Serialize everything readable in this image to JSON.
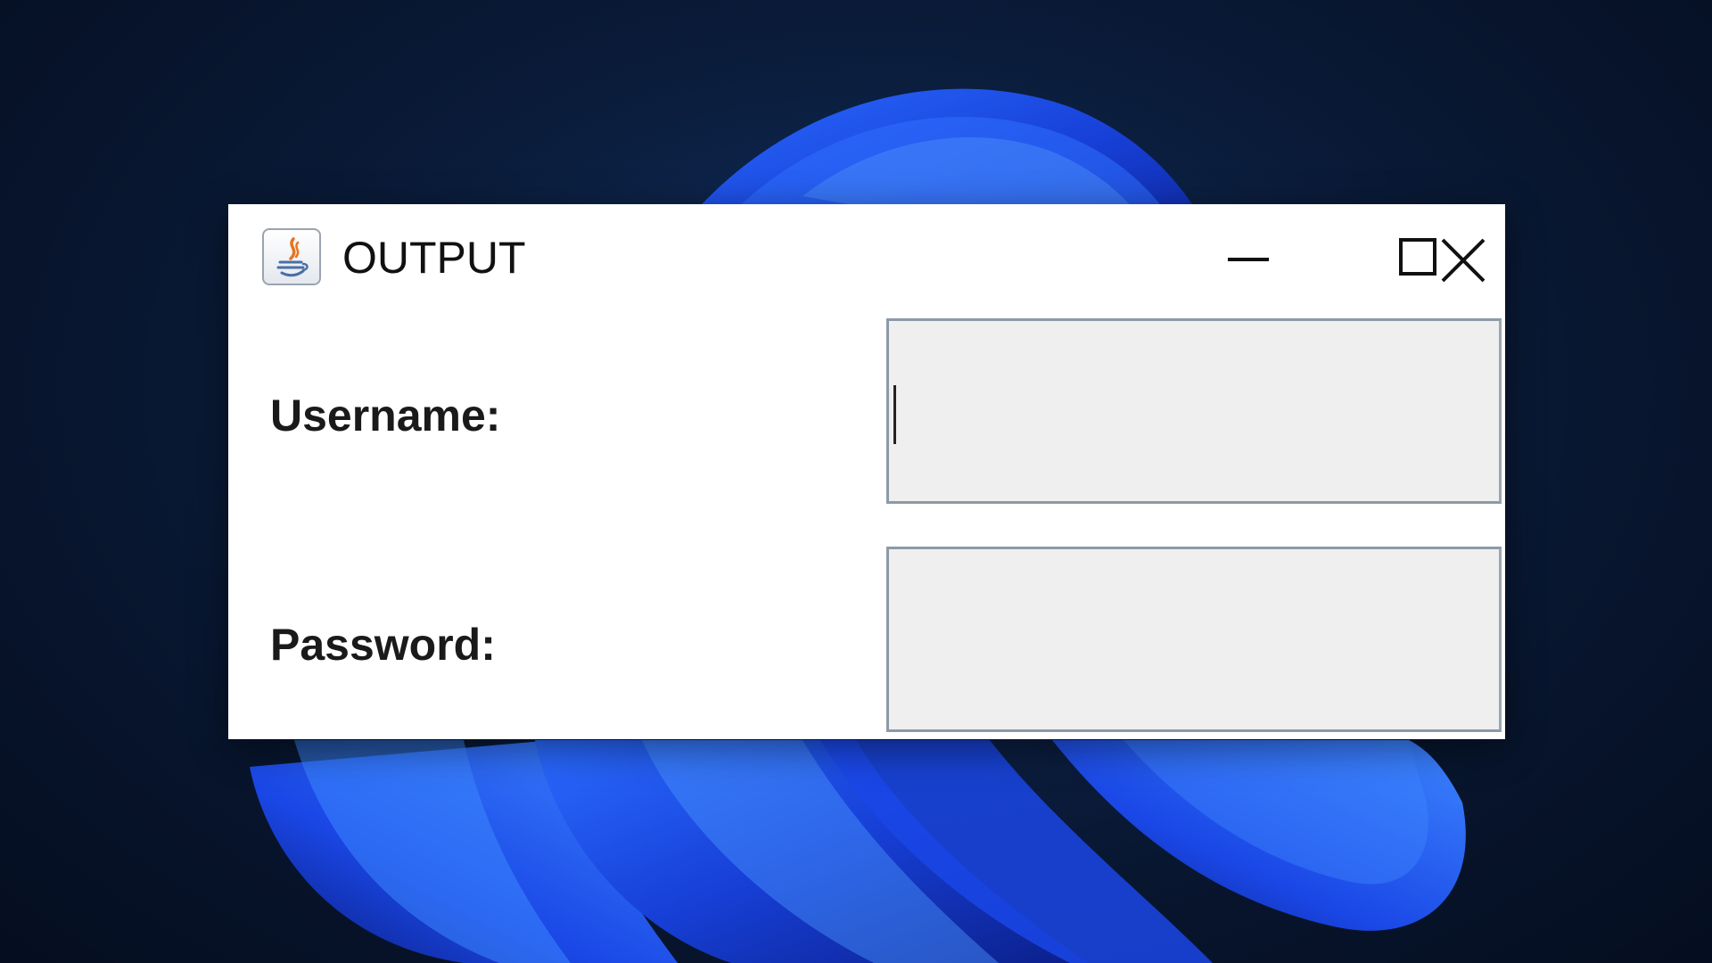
{
  "window": {
    "title": "OUTPUT",
    "app_icon": "java-icon",
    "controls": {
      "minimize": "minimize-icon",
      "maximize": "maximize-icon",
      "close": "close-icon"
    }
  },
  "form": {
    "username_label": "Username:",
    "username_value": "",
    "password_label": "Password:",
    "password_value": ""
  },
  "colors": {
    "window_bg": "#ffffff",
    "field_bg": "#efefef",
    "field_border": "#8c9aa8",
    "wallpaper_accent": "#1f4fe0"
  }
}
